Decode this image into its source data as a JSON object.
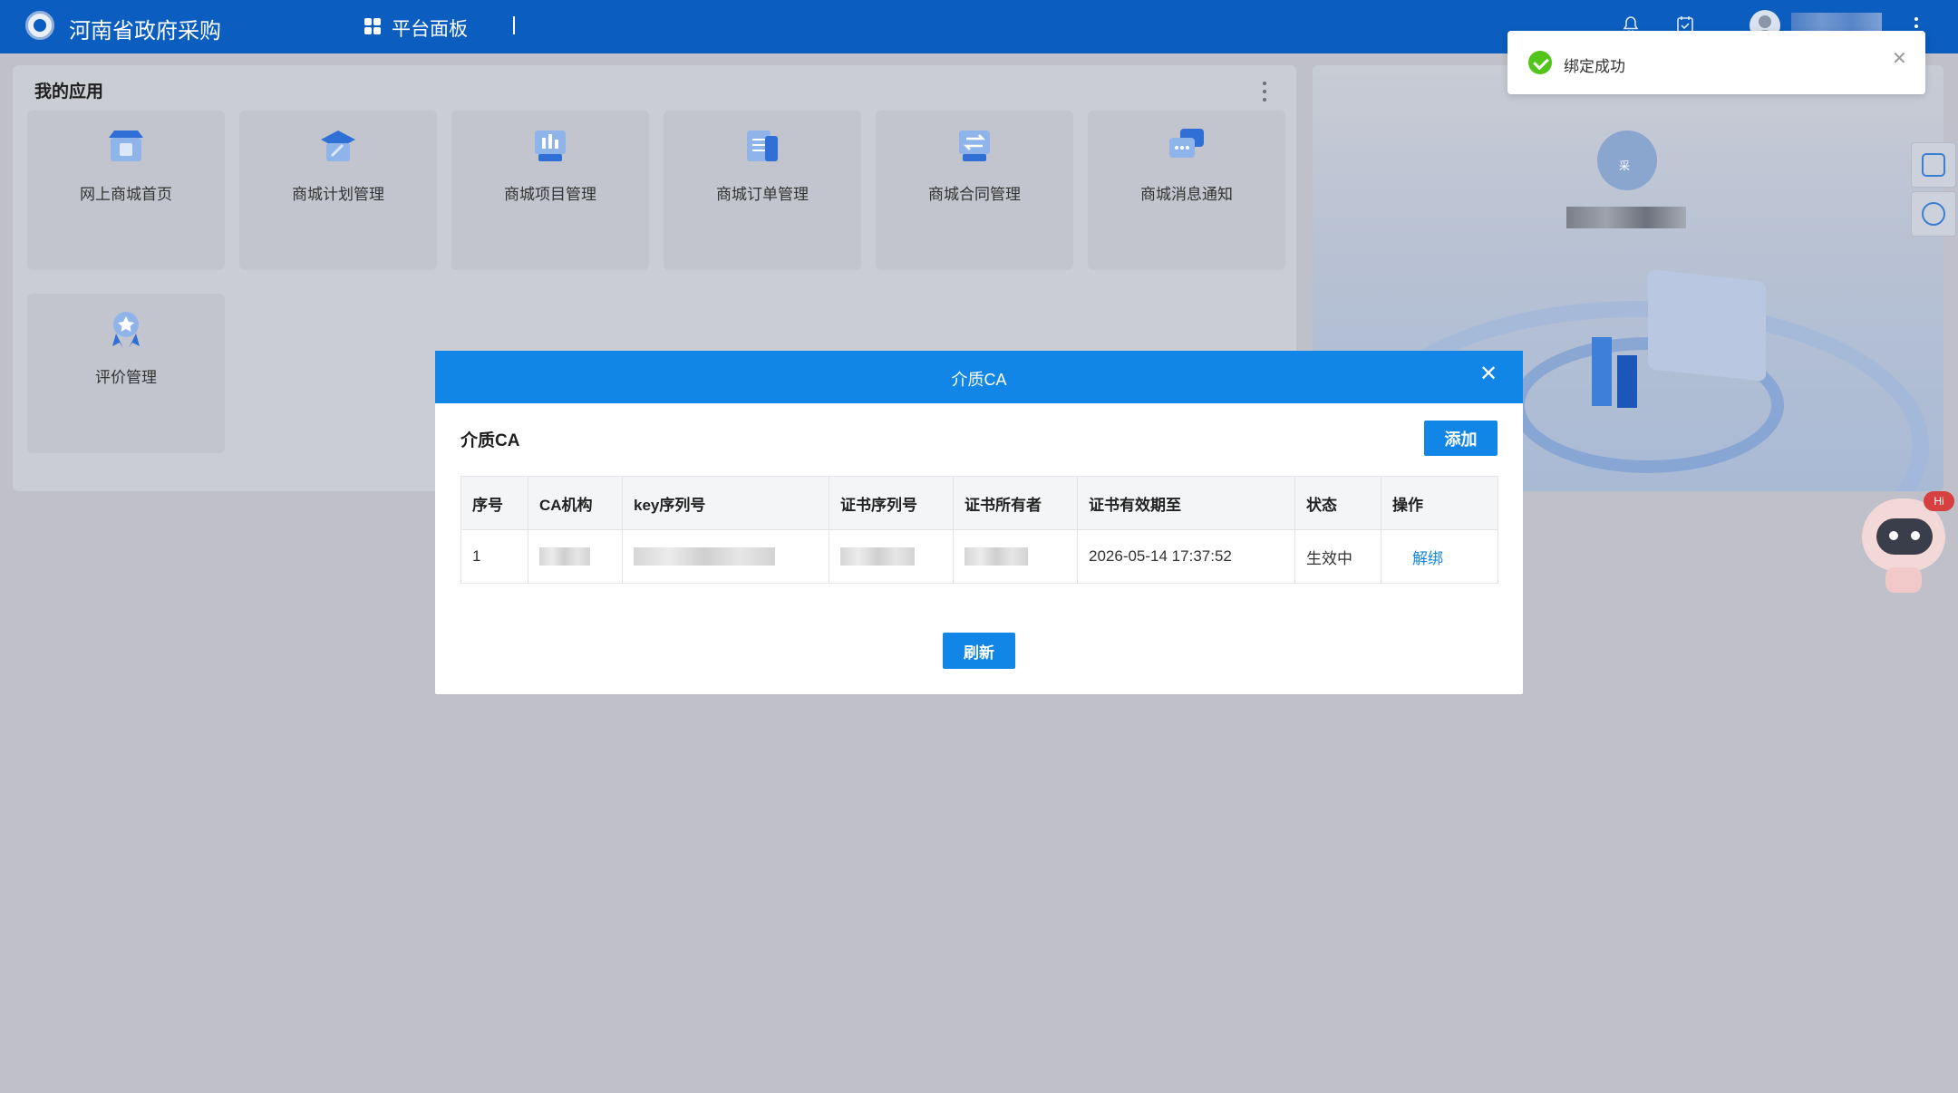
{
  "header": {
    "app_title": "河南省政府采购",
    "nav_label": "平台面板"
  },
  "apps": {
    "title": "我的应用",
    "tiles": [
      {
        "label": "网上商城首页",
        "icon": "store-icon"
      },
      {
        "label": "商城计划管理",
        "icon": "graduation-cap-icon"
      },
      {
        "label": "商城项目管理",
        "icon": "chart-board-icon"
      },
      {
        "label": "商城订单管理",
        "icon": "document-list-icon"
      },
      {
        "label": "商城合同管理",
        "icon": "exchange-icon"
      },
      {
        "label": "商城消息通知",
        "icon": "chat-bubble-icon"
      },
      {
        "label": "评价管理",
        "icon": "star-badge-icon"
      }
    ]
  },
  "toast": {
    "message": "绑定成功"
  },
  "modal": {
    "title": "介质CA",
    "section_title": "介质CA",
    "add_label": "添加",
    "refresh_label": "刷新",
    "table": {
      "columns": [
        "序号",
        "CA机构",
        "key序列号",
        "证书序列号",
        "证书所有者",
        "证书有效期至",
        "状态",
        "操作"
      ],
      "rows": [
        {
          "index": "1",
          "expiry": "2026-05-14 17:37:52",
          "status": "生效中",
          "action": "解绑"
        }
      ]
    }
  },
  "mascot": {
    "badge": "Hi"
  },
  "user_card": {
    "avatar_char": "采"
  },
  "colors": {
    "header_bg": "#0b5dbf",
    "primary": "#1186e7",
    "success": "#52c41a",
    "overlay": "#bfc0c9"
  }
}
